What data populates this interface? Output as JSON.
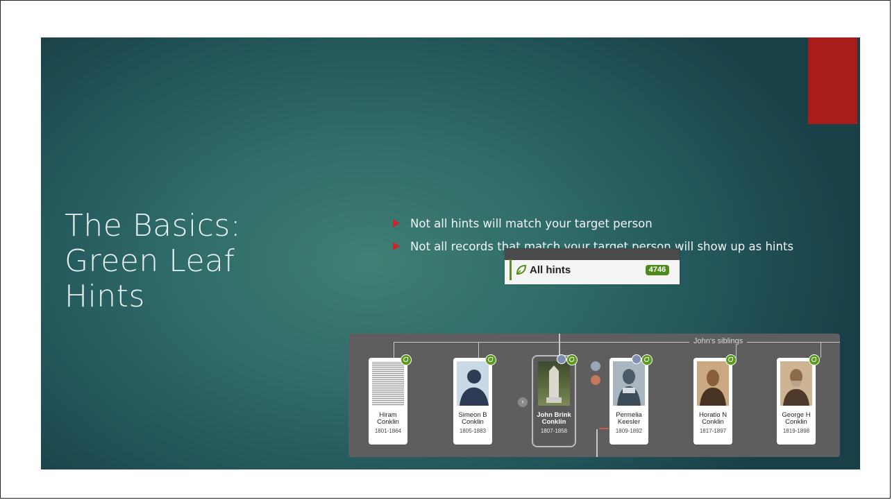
{
  "slide": {
    "title_lines": [
      "The Basics:",
      "Green Leaf",
      "Hints"
    ],
    "bullets": [
      "Not all hints will match your target person",
      "Not all records that match your target person will show up as hints"
    ],
    "colors": {
      "accent_red": "#a81c1c",
      "bullet_arrow": "#c62828",
      "hint_green": "#4f8a1f"
    }
  },
  "hints_widget": {
    "label": "All hints",
    "count": "4746",
    "icon": "leaf-icon"
  },
  "family_tree": {
    "siblings_label": "John's siblings",
    "people": [
      {
        "first": "Hiram",
        "last": "Conklin",
        "dates": "1801-1864",
        "photo": "document-image"
      },
      {
        "first": "Simeon B",
        "last": "Conklin",
        "dates": "1805-1883",
        "photo": "silhouette-avatar"
      },
      {
        "first": "John Brink",
        "last": "Conklin",
        "dates": "1807-1858",
        "photo": "gravestone-photo"
      },
      {
        "first": "Permelia",
        "last": "Keesler",
        "dates": "1809-1892",
        "photo": "portrait-photo"
      },
      {
        "first": "Horatio N",
        "last": "Conklin",
        "dates": "1817-1897",
        "photo": "portrait-photo"
      },
      {
        "first": "George H",
        "last": "Conklin",
        "dates": "1819-1898",
        "photo": "portrait-photo"
      }
    ]
  }
}
